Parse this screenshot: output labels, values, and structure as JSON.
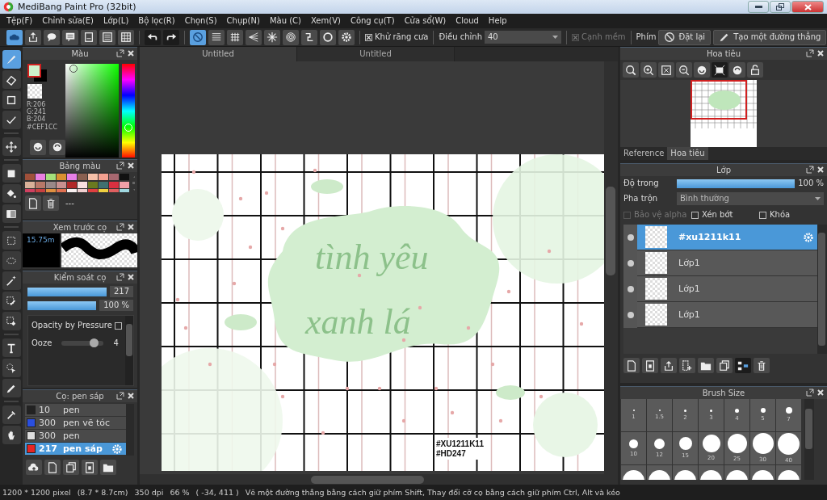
{
  "window": {
    "title": "MediBang Paint Pro (32bit)"
  },
  "menu": [
    "Tệp(F)",
    "Chỉnh sửa(E)",
    "Lớp(L)",
    "Bộ lọc(R)",
    "Chọn(S)",
    "Chụp(N)",
    "Màu (C)",
    "Xem(V)",
    "Công cụ(T)",
    "Cửa sổ(W)",
    "Cloud",
    "Help"
  ],
  "toolbar": {
    "snap_modes": [
      {
        "kind": "none",
        "selected": true
      },
      {
        "kind": "parallel",
        "selected": false
      },
      {
        "kind": "cross",
        "selected": false
      },
      {
        "kind": "fan",
        "selected": false
      },
      {
        "kind": "burst",
        "selected": false
      },
      {
        "kind": "concentric",
        "selected": false
      },
      {
        "kind": "curve",
        "selected": false
      },
      {
        "kind": "circle",
        "selected": false
      },
      {
        "kind": "ellipse",
        "selected": false
      }
    ],
    "antialias": {
      "label": "Khử răng cưa",
      "checked": true
    },
    "adjust": {
      "label": "Điều chỉnh",
      "value": "40"
    },
    "soft_edge": {
      "label": "Cạnh mềm",
      "checked": true,
      "disabled": true
    },
    "key_label": "Phím",
    "reset_button": "Đặt lại",
    "line_button": "Tạo một đường thẳng"
  },
  "tools": [
    {
      "kind": "brush",
      "selected": true
    },
    {
      "kind": "eraser",
      "selected": false
    },
    {
      "kind": "square",
      "selected": false
    },
    {
      "kind": "polyline",
      "selected": false
    },
    {
      "kind": "move",
      "selected": false
    },
    {
      "kind": "fillrect",
      "selected": false
    },
    {
      "kind": "bucket",
      "selected": false
    },
    {
      "kind": "gradient",
      "selected": false
    },
    {
      "kind": "selrect",
      "selected": false
    },
    {
      "kind": "lasso",
      "selected": false
    },
    {
      "kind": "wand",
      "selected": false
    },
    {
      "kind": "selpen",
      "selected": false
    },
    {
      "kind": "seleraser",
      "selected": false
    },
    {
      "kind": "text",
      "selected": false
    },
    {
      "kind": "selpointer",
      "selected": false
    },
    {
      "kind": "pencil",
      "selected": false
    },
    {
      "kind": "dropper",
      "selected": false
    },
    {
      "kind": "hand",
      "selected": false
    }
  ],
  "color_panel": {
    "title": "Màu",
    "color": "#cef1cc",
    "values": [
      "R:206",
      "G:241",
      "B:204",
      "#CEF1CC"
    ]
  },
  "palette_panel": {
    "title": "Bảng màu",
    "name": "---",
    "swatches": [
      {
        "color": "#a0503a"
      },
      {
        "color": "#e97fe0"
      },
      {
        "color": "#a4e07a"
      },
      {
        "color": "#d99030"
      },
      {
        "color": "#e77fe6"
      },
      {
        "color": "#8a6050"
      },
      {
        "color": "#f7c0a8"
      },
      {
        "color": "#f4a090"
      },
      {
        "color": "#a86870"
      },
      {
        "color": "#111111"
      },
      {
        "color": "#d8b098"
      },
      {
        "color": "#b87868"
      },
      {
        "color": "#9a8888"
      },
      {
        "color": "#c89090"
      },
      {
        "color": "#b02828"
      },
      {
        "color": "#f8e0e0"
      },
      {
        "color": "#6a7a20"
      },
      {
        "color": "#407070"
      },
      {
        "color": "#d83040"
      },
      {
        "color": "#f0a0a8"
      },
      {
        "color": "#d04060"
      },
      {
        "color": "#c84040"
      },
      {
        "color": "#e09040"
      },
      {
        "color": "#e07050"
      },
      {
        "color": "#f8f0f0"
      },
      {
        "color": "#f0d0d0"
      },
      {
        "color": "#e04040"
      },
      {
        "color": "#f0d040"
      },
      {
        "color": "#e06060"
      },
      {
        "color": "#a0d8e0"
      }
    ]
  },
  "brush_preview": {
    "title": "Xem trước cọ",
    "size": "15.75m"
  },
  "brush_control": {
    "title": "Kiểm soát cọ",
    "size": {
      "level": 1,
      "value": "217"
    },
    "opacity": {
      "level": 1,
      "value": "100 %"
    },
    "pressure": {
      "label": "Opacity by Pressure",
      "checked": false
    },
    "ooze": {
      "label": "Ooze",
      "level": 0.78,
      "value": "4"
    }
  },
  "brush_list": {
    "title": "Cọ: pen sáp",
    "items": [
      {
        "color": "#222222",
        "size": "10",
        "name": "pen",
        "selected": false
      },
      {
        "color": "#2a4fe0",
        "size": "300",
        "name": "pen vẽ tóc",
        "selected": false
      },
      {
        "color": "#dddddd",
        "size": "300",
        "name": "pen",
        "selected": false
      },
      {
        "color": "#e52525",
        "size": "217",
        "name": "pen sáp",
        "selected": true
      }
    ]
  },
  "document_tabs": [
    {
      "label": "Untitled",
      "selected": true
    },
    {
      "label": "Untitled",
      "selected": false
    }
  ],
  "canvas": {
    "texts": [
      {
        "kind": "handwriting",
        "text": "tình yêu"
      },
      {
        "kind": "handwriting",
        "text": "xanh lá"
      },
      {
        "kind": "tag",
        "text": "#XU1211K11"
      },
      {
        "kind": "tag",
        "text": "#HD247"
      }
    ]
  },
  "navigator": {
    "title": "Hoa tiêu",
    "tabs": [
      {
        "label": "Reference",
        "selected": false
      },
      {
        "label": "Hoa tiêu",
        "selected": true
      }
    ]
  },
  "layer_panel": {
    "title": "Lớp",
    "opacity": {
      "label": "Độ trong",
      "level": 1,
      "value": "100 %"
    },
    "blend": {
      "label": "Pha trộn",
      "value": "Bình thường"
    },
    "options": [
      {
        "label": "Bảo vệ alpha",
        "checked": false,
        "disabled": true
      },
      {
        "label": "Xén bớt",
        "checked": false,
        "disabled": false
      },
      {
        "label": "Khóa",
        "checked": false,
        "disabled": false
      }
    ],
    "layers": [
      {
        "name": "#xu1211k11",
        "selected": true
      },
      {
        "name": "Lớp1",
        "selected": false
      },
      {
        "name": "Lớp1",
        "selected": false
      },
      {
        "name": "Lớp1",
        "selected": false
      }
    ]
  },
  "brush_size_panel": {
    "title": "Brush Size",
    "sizes": [
      "1",
      "1.5",
      "2",
      "3",
      "4",
      "5",
      "7",
      "10",
      "12",
      "15",
      "20",
      "25",
      "30",
      "40"
    ]
  },
  "status_bar": [
    "1200 * 1200 pixel",
    "(8.7 * 8.7cm)",
    "350 dpi",
    "66 %",
    "( -34, 411 )",
    "Vẽ một đường thẳng bằng cách giữ phím Shift, Thay đổi cỡ cọ bằng cách giữ phím Ctrl, Alt và kéo"
  ]
}
